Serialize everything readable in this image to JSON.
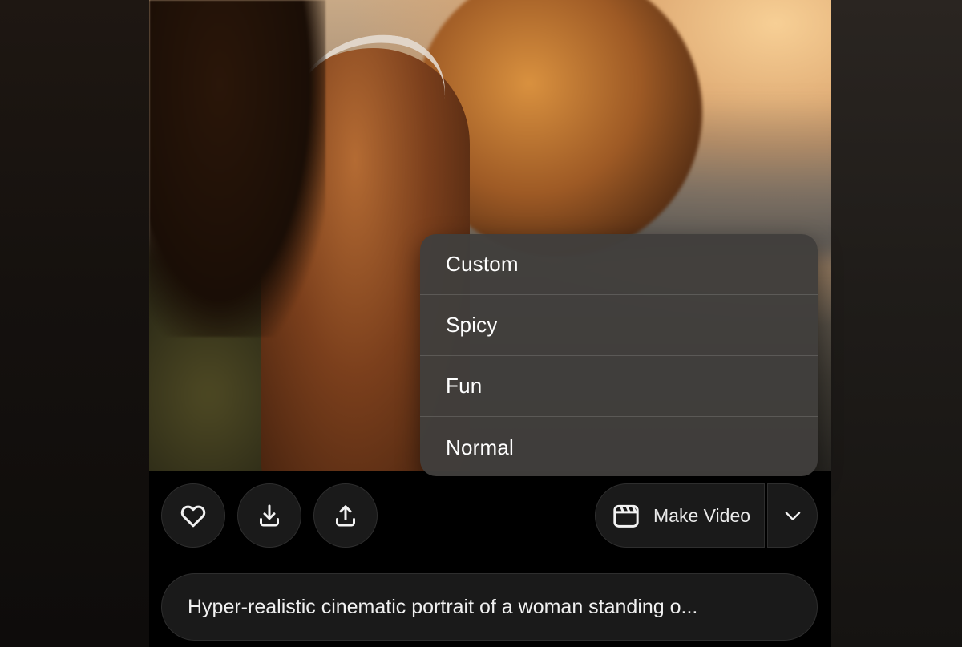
{
  "menu": {
    "items": [
      {
        "label": "Custom"
      },
      {
        "label": "Spicy"
      },
      {
        "label": "Fun"
      },
      {
        "label": "Normal"
      }
    ]
  },
  "toolbar": {
    "favorite_icon": "heart-icon",
    "download_icon": "download-icon",
    "share_icon": "upload-icon",
    "make_video_label": "Make Video",
    "make_video_icon": "clapperboard-icon",
    "dropdown_icon": "chevron-down-icon"
  },
  "prompt": {
    "text": "Hyper-realistic cinematic portrait of a woman standing o..."
  },
  "colors": {
    "background": "#000000",
    "button_bg": "#1a1a1a",
    "menu_bg": "#413e3c",
    "text": "#ffffff"
  }
}
